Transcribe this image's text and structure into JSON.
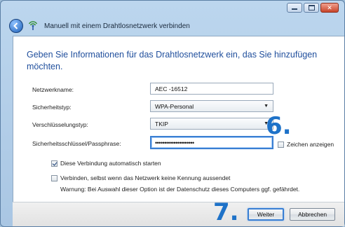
{
  "window": {
    "title": "Manuell mit einem Drahtlosnetzwerk verbinden",
    "icons": {
      "back": "back-arrow-icon",
      "network": "wireless-network-icon",
      "minimize": "minimize-icon",
      "maximize": "maximize-icon",
      "close": "close-icon"
    }
  },
  "main": {
    "heading": "Geben Sie Informationen für das Drahtlosnetzwerk ein, das Sie hinzufügen möchten.",
    "fields": {
      "network_name": {
        "label": "Netzwerkname:",
        "value": "AEC -16512"
      },
      "security_type": {
        "label": "Sicherheitstyp:",
        "value": "WPA-Personal"
      },
      "encryption_type": {
        "label": "Verschlüsselungstyp:",
        "value": "TKIP"
      },
      "security_key": {
        "label": "Sicherheitsschlüssel/Passphrase:",
        "value": "•••••••••••••••••••••"
      }
    },
    "show_characters": {
      "label": "Zeichen anzeigen",
      "checked": false
    },
    "auto_start": {
      "label": "Diese Verbindung automatisch starten",
      "checked": true
    },
    "connect_hidden": {
      "label": "Verbinden, selbst wenn das Netzwerk keine Kennung aussendet",
      "checked": false
    },
    "warning": "Warnung: Bei Auswahl dieser Option ist der Datenschutz dieses Computers ggf. gefährdet."
  },
  "footer": {
    "next_label": "Weiter",
    "cancel_label": "Abbrechen"
  },
  "annotations": {
    "step6": "6.",
    "step7": "7."
  },
  "colors": {
    "accent": "#1e72c8",
    "heading": "#1f4e9c",
    "focus": "#3a7fd3"
  }
}
